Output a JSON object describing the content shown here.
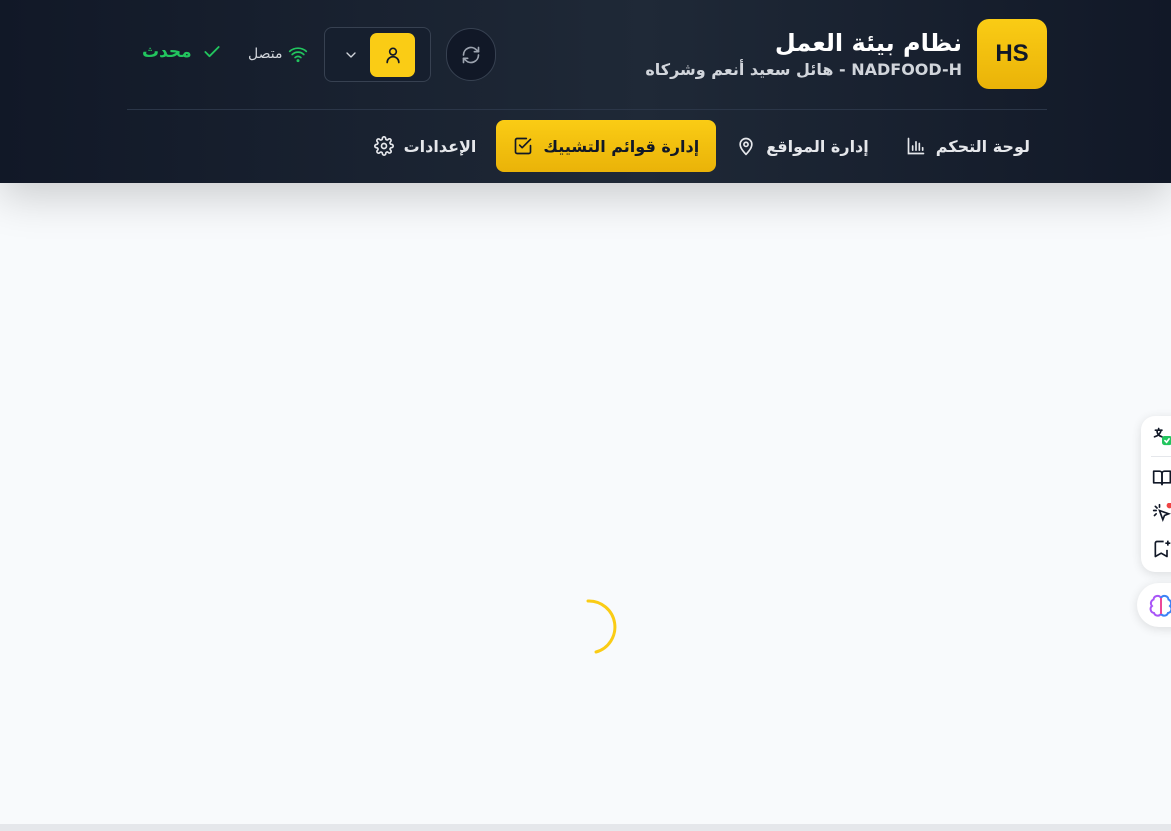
{
  "header": {
    "logo_text": "HS",
    "title": "نظام بيئة العمل",
    "subtitle": "NADFOOD-H - هائل سعيد أنعم وشركاه",
    "connection_label": "متصل",
    "status_label": "محدث"
  },
  "nav": {
    "items": [
      {
        "label": "لوحة التحكم",
        "icon": "bar-chart-icon",
        "active": false
      },
      {
        "label": "إدارة المواقع",
        "icon": "map-pin-icon",
        "active": false
      },
      {
        "label": "إدارة قوائم التشييك",
        "icon": "checkbox-icon",
        "active": true
      },
      {
        "label": "الإعدادات",
        "icon": "gear-icon",
        "active": false
      }
    ]
  },
  "colors": {
    "header_bg": "#111827",
    "accent": "#facc15",
    "status_green": "#22c55e",
    "page_bg": "#f8fafc"
  },
  "side_tools": [
    "translate-icon",
    "book-icon",
    "pointer-sparkle-icon",
    "bookmark-add-icon",
    "brain-icon"
  ]
}
